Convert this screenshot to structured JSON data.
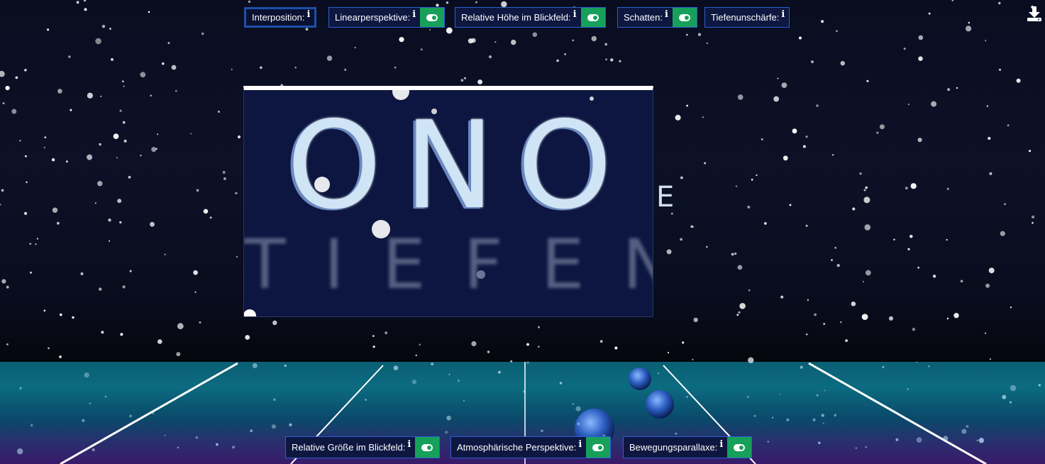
{
  "top_toggles": [
    {
      "label": "Interposition:",
      "info": "i",
      "has_switch": false,
      "active": true
    },
    {
      "label": "Linearperspektive:",
      "info": "i",
      "has_switch": true
    },
    {
      "label": "Relative Höhe im Blickfeld:",
      "info": "i",
      "has_switch": true
    },
    {
      "label": "Schatten:",
      "info": "i",
      "has_switch": true
    },
    {
      "label": "Tiefenunschärfe:",
      "info": "i",
      "has_switch": false
    }
  ],
  "bottom_toggles": [
    {
      "label": "Relative Größe im Blickfeld:",
      "info": "i",
      "has_switch": true
    },
    {
      "label": "Atmosphärische Perspektive:",
      "info": "i",
      "has_switch": true
    },
    {
      "label": "Bewegungsparallaxe:",
      "info": "i",
      "has_switch": true
    }
  ],
  "scene": {
    "big_word": "ONO",
    "small_word": "TIEFEN",
    "side_letter": "E"
  },
  "icons": {
    "download": "download-icon",
    "info": "info-icon",
    "switch": "toggle-switch-icon"
  },
  "colors": {
    "chip_border": "#2a5fd0",
    "chip_bg": "#0d1740",
    "switch_on": "#17a05a",
    "sky": "#0c1128",
    "floor": "#0c6b80"
  }
}
